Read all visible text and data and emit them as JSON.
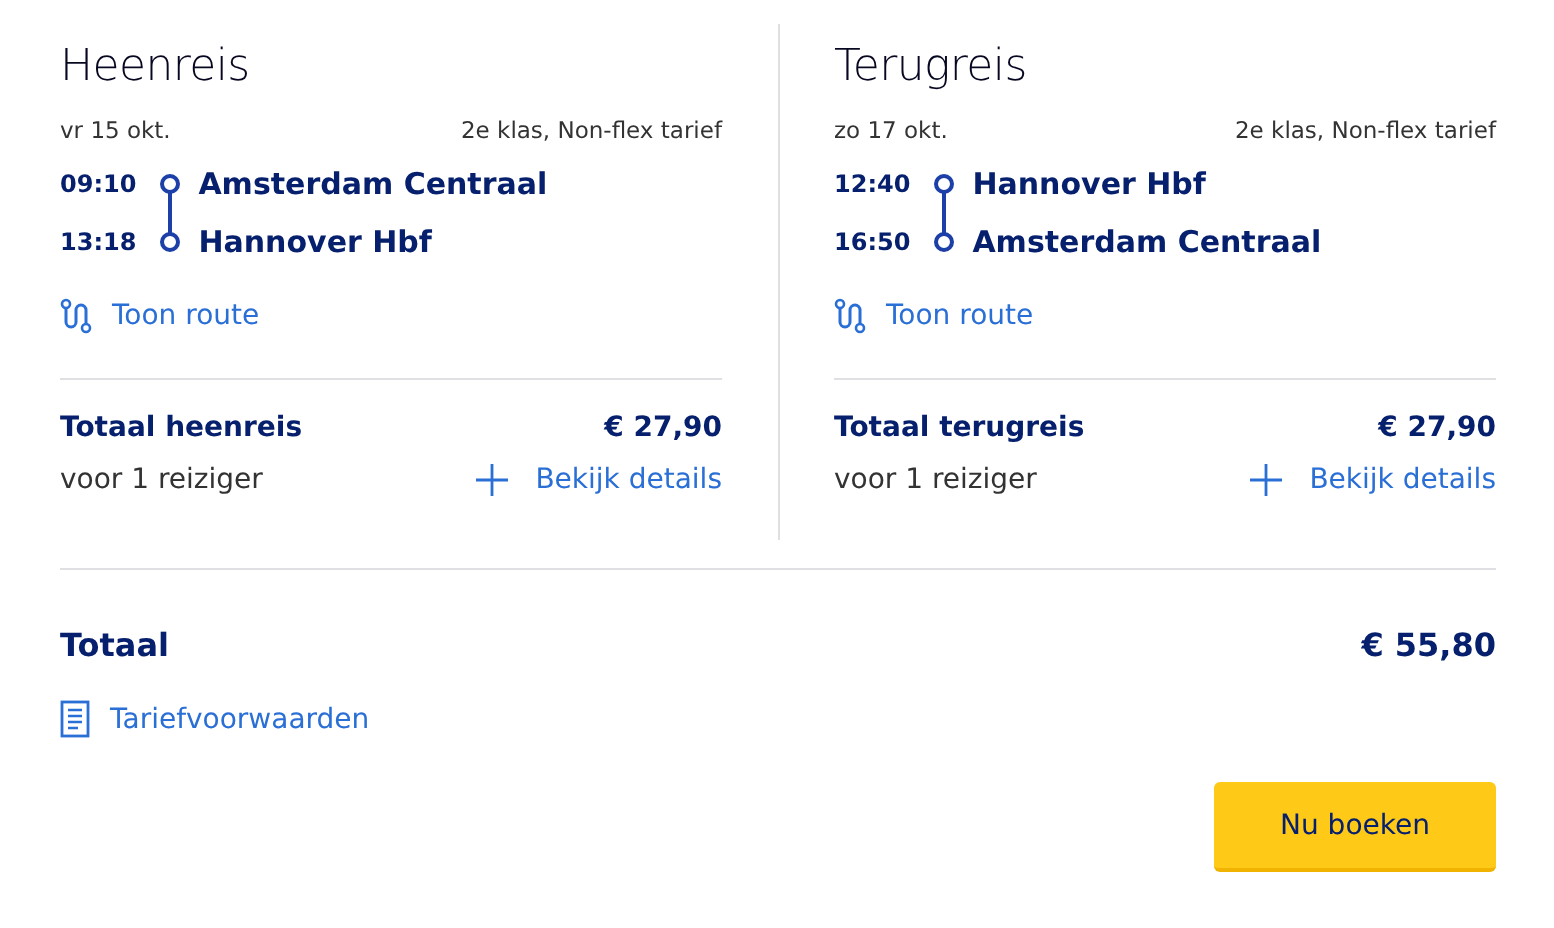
{
  "journeys": [
    {
      "title": "Heenreis",
      "date": "vr 15 okt.",
      "fare": "2e klas, Non-flex tarief",
      "stops": [
        {
          "time": "09:10",
          "station": "Amsterdam Centraal"
        },
        {
          "time": "13:18",
          "station": "Hannover Hbf"
        }
      ],
      "route_link": "Toon route",
      "total_label": "Totaal heenreis",
      "total_price": "€ 27,90",
      "travellers": "voor 1 reiziger",
      "details_link": "Bekijk details"
    },
    {
      "title": "Terugreis",
      "date": "zo 17 okt.",
      "fare": "2e klas, Non-flex tarief",
      "stops": [
        {
          "time": "12:40",
          "station": "Hannover Hbf"
        },
        {
          "time": "16:50",
          "station": "Amsterdam Centraal"
        }
      ],
      "route_link": "Toon route",
      "total_label": "Totaal terugreis",
      "total_price": "€ 27,90",
      "travellers": "voor 1 reiziger",
      "details_link": "Bekijk details"
    }
  ],
  "total": {
    "label": "Totaal",
    "price": "€ 55,80"
  },
  "conditions_link": "Tariefvoorwaarden",
  "book_button": "Nu boeken"
}
